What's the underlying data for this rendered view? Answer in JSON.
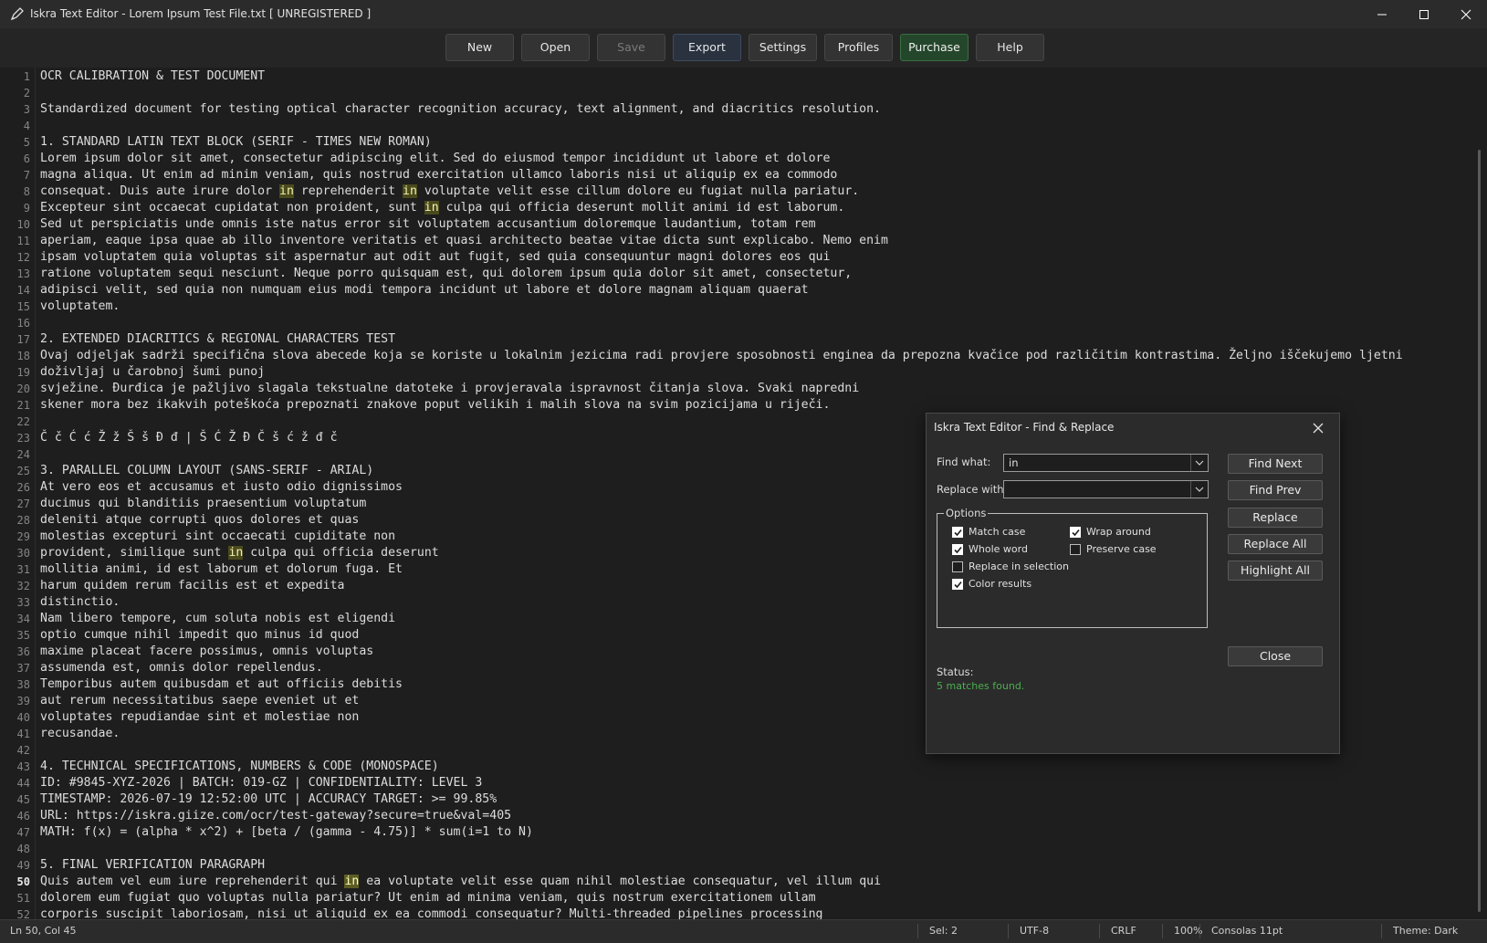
{
  "window": {
    "title": "Iskra Text Editor - Lorem Ipsum Test File.txt  [ UNREGISTERED ]"
  },
  "toolbar": {
    "buttons": [
      {
        "label": "New"
      },
      {
        "label": "Open"
      },
      {
        "label": "Save"
      },
      {
        "label": "Export"
      },
      {
        "label": "Settings"
      },
      {
        "label": "Profiles"
      },
      {
        "label": "Purchase"
      },
      {
        "label": "Help"
      }
    ]
  },
  "editor": {
    "current_line": 50,
    "lines": [
      "OCR CALIBRATION & TEST DOCUMENT",
      "",
      "Standardized document for testing optical character recognition accuracy, text alignment, and diacritics resolution.",
      "",
      "1. STANDARD LATIN TEXT BLOCK (SERIF - TIMES NEW ROMAN)",
      "Lorem ipsum dolor sit amet, consectetur adipiscing elit. Sed do eiusmod tempor incididunt ut labore et dolore",
      "magna aliqua. Ut enim ad minim veniam, quis nostrud exercitation ullamco laboris nisi ut aliquip ex ea commodo",
      "consequat. Duis aute irure dolor in reprehenderit in voluptate velit esse cillum dolore eu fugiat nulla pariatur.",
      "Excepteur sint occaecat cupidatat non proident, sunt in culpa qui officia deserunt mollit animi id est laborum.",
      "Sed ut perspiciatis unde omnis iste natus error sit voluptatem accusantium doloremque laudantium, totam rem",
      "aperiam, eaque ipsa quae ab illo inventore veritatis et quasi architecto beatae vitae dicta sunt explicabo. Nemo enim",
      "ipsam voluptatem quia voluptas sit aspernatur aut odit aut fugit, sed quia consequuntur magni dolores eos qui",
      "ratione voluptatem sequi nesciunt. Neque porro quisquam est, qui dolorem ipsum quia dolor sit amet, consectetur,",
      "adipisci velit, sed quia non numquam eius modi tempora incidunt ut labore et dolore magnam aliquam quaerat",
      "voluptatem.",
      "",
      "2. EXTENDED DIACRITICS & REGIONAL CHARACTERS TEST",
      "Ovaj odjeljak sadrži specifična slova abecede koja se koriste u lokalnim jezicima radi provjere sposobnosti enginea da prepozna kvačice pod različitim kontrastima. Željno iščekujemo ljetni",
      "doživljaj u čarobnoj šumi punoj",
      "svježine. Đurđica je pažljivo slagala tekstualne datoteke i provjeravala ispravnost čitanja slova. Svaki napredni",
      "skener mora bez ikakvih poteškoća prepoznati znakove poput velikih i malih slova na svim pozicijama u riječi.",
      "",
      "Č č Ć ć Ž ž Š š Đ đ | Š Ć Ž Đ Č š ć ž đ č",
      "",
      "3. PARALLEL COLUMN LAYOUT (SANS-SERIF - ARIAL)",
      "At vero eos et accusamus et iusto odio dignissimos",
      "ducimus qui blanditiis praesentium voluptatum",
      "deleniti atque corrupti quos dolores et quas",
      "molestias excepturi sint occaecati cupiditate non",
      "provident, similique sunt in culpa qui officia deserunt",
      "mollitia animi, id est laborum et dolorum fuga. Et",
      "harum quidem rerum facilis est et expedita",
      "distinctio.",
      "Nam libero tempore, cum soluta nobis est eligendi",
      "optio cumque nihil impedit quo minus id quod",
      "maxime placeat facere possimus, omnis voluptas",
      "assumenda est, omnis dolor repellendus.",
      "Temporibus autem quibusdam et aut officiis debitis",
      "aut rerum necessitatibus saepe eveniet ut et",
      "voluptates repudiandae sint et molestiae non",
      "recusandae.",
      "",
      "4. TECHNICAL SPECIFICATIONS, NUMBERS & CODE (MONOSPACE)",
      "ID: #9845-XYZ-2026 | BATCH: 019-GZ | CONFIDENTIALITY: LEVEL 3",
      "TIMESTAMP: 2026-07-19 12:52:00 UTC | ACCURACY TARGET: >= 99.85%",
      "URL: https://iskra.giize.com/ocr/test-gateway?secure=true&val=405",
      "MATH: f(x) = (alpha * x^2) + [beta / (gamma - 4.75)] * sum(i=1 to N)",
      "",
      "5. FINAL VERIFICATION PARAGRAPH",
      "Quis autem vel eum iure reprehenderit qui in ea voluptate velit esse quam nihil molestiae consequatur, vel illum qui",
      "dolorem eum fugiat quo voluptas nulla pariatur? Ut enim ad minima veniam, quis nostrum exercitationem ullam",
      "corporis suscipit laboriosam, nisi ut aliquid ex ea commodi consequatur? Multi-threaded pipelines processing"
    ],
    "highlight_word": "in"
  },
  "dialog": {
    "title": "Iskra Text Editor - Find & Replace",
    "find_label": "Find what:",
    "find_value": "in",
    "replace_label": "Replace with:",
    "replace_value": "",
    "options_label": "Options",
    "options": {
      "match_case": {
        "label": "Match case",
        "checked": true
      },
      "wrap_around": {
        "label": "Wrap around",
        "checked": true
      },
      "whole_word": {
        "label": "Whole word",
        "checked": true
      },
      "preserve_case": {
        "label": "Preserve case",
        "checked": false
      },
      "replace_in_selection": {
        "label": "Replace in selection",
        "checked": false
      },
      "color_results": {
        "label": "Color results",
        "checked": true
      }
    },
    "buttons": {
      "find_next": "Find Next",
      "find_prev": "Find Prev",
      "replace": "Replace",
      "replace_all": "Replace All",
      "highlight_all": "Highlight All",
      "close": "Close"
    },
    "status_label": "Status:",
    "status_value": "5 matches found.",
    "status_color": "#4caf50"
  },
  "statusbar": {
    "position": "Ln 50, Col 45",
    "selection": "Sel: 2",
    "encoding": "UTF-8",
    "line_ending": "CRLF",
    "zoom": "100%",
    "font": "Consolas 11pt",
    "theme": "Theme: Dark"
  },
  "colors": {
    "background": "#1e1e1e",
    "highlight": "#4a4a1c",
    "purchase": "#24472b",
    "status_ok": "#4caf50"
  }
}
